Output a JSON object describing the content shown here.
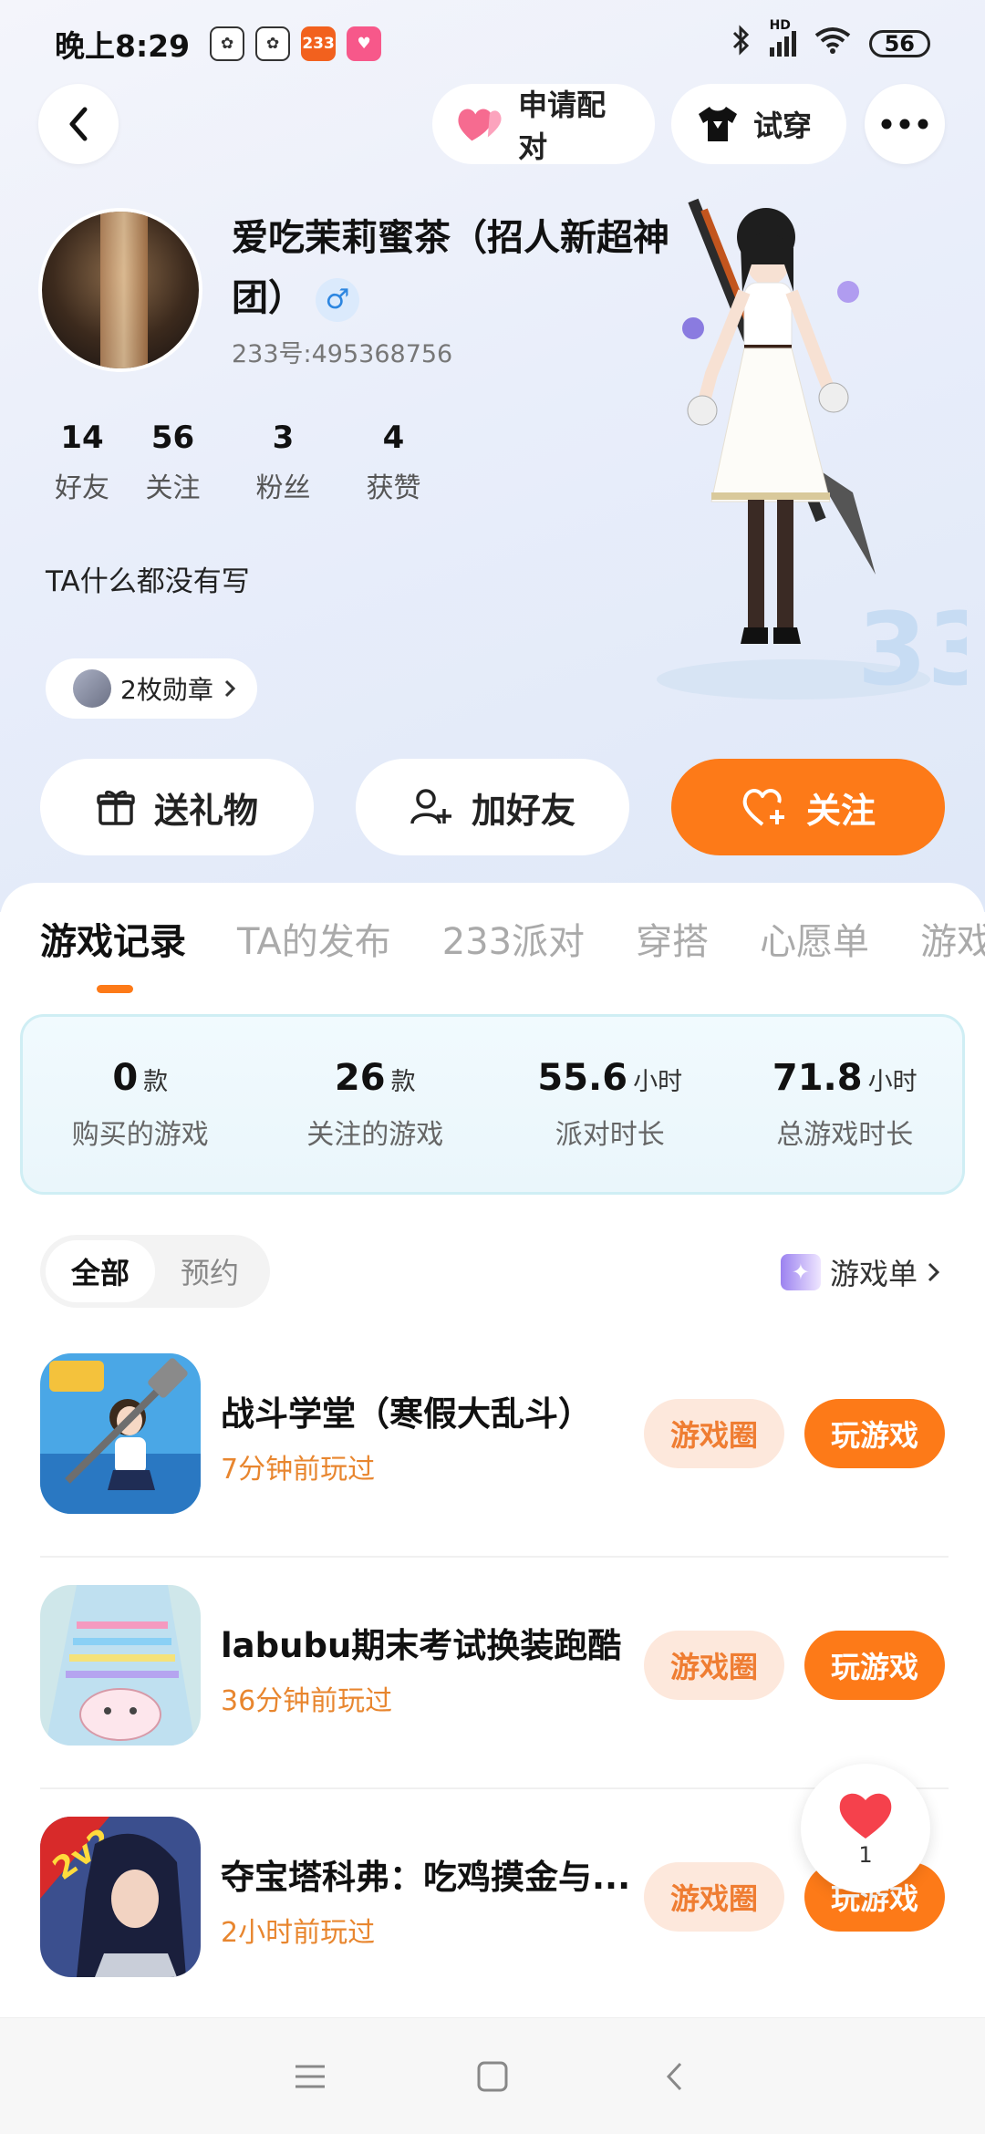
{
  "status_bar": {
    "time": "晚上8:29",
    "apps": [
      {
        "name": "baidu-paw-icon",
        "color": "#ffffff"
      },
      {
        "name": "baidu-paw-icon",
        "color": "#ffffff"
      },
      {
        "name": "app-233-icon",
        "label": "233",
        "color": "#f2611e"
      },
      {
        "name": "pink-app-icon",
        "color": "#f7588a"
      }
    ],
    "signal_label": "HD",
    "battery": "56"
  },
  "header": {
    "apply_pair_label": "申请配对",
    "try_on_label": "试穿"
  },
  "profile": {
    "name": "爱吃茉莉蜜茶（招人新超神团）",
    "gender_symbol": "♂",
    "uid": "233号:495368756",
    "stats": [
      {
        "value": "14",
        "label": "好友"
      },
      {
        "value": "56",
        "label": "关注"
      },
      {
        "value": "3",
        "label": "粉丝"
      },
      {
        "value": "4",
        "label": "获赞"
      }
    ],
    "bio": "TA什么都没有写",
    "medals": "2枚勋章"
  },
  "actions": {
    "gift": "送礼物",
    "add_friend": "加好友",
    "follow": "关注"
  },
  "tabs": [
    "游戏记录",
    "TA的发布",
    "233派对",
    "穿搭",
    "心愿单",
    "游戏"
  ],
  "summary": [
    {
      "value": "0",
      "unit": "款",
      "label": "购买的游戏"
    },
    {
      "value": "26",
      "unit": "款",
      "label": "关注的游戏"
    },
    {
      "value": "55.6",
      "unit": "小时",
      "label": "派对时长"
    },
    {
      "value": "71.8",
      "unit": "小时",
      "label": "总游戏时长"
    }
  ],
  "filter": {
    "all": "全部",
    "reserve": "预约"
  },
  "game_list_link": "游戏单",
  "games": [
    {
      "title": "战斗学堂（寒假大乱斗）",
      "time": "7分钟前玩过",
      "circle": "游戏圈",
      "play": "玩游戏"
    },
    {
      "title": "labubu期末考试换装跑酷",
      "time": "36分钟前玩过",
      "circle": "游戏圈",
      "play": "玩游戏"
    },
    {
      "title": "夺宝塔科弗：吃鸡摸金与...",
      "time": "2小时前玩过",
      "circle": "游戏圈",
      "play": "玩游戏"
    }
  ],
  "like_float": {
    "count": "1"
  },
  "colors": {
    "accent": "#fd7a18",
    "time_text": "#e8862f",
    "soft_orange": "#fde8dc"
  }
}
